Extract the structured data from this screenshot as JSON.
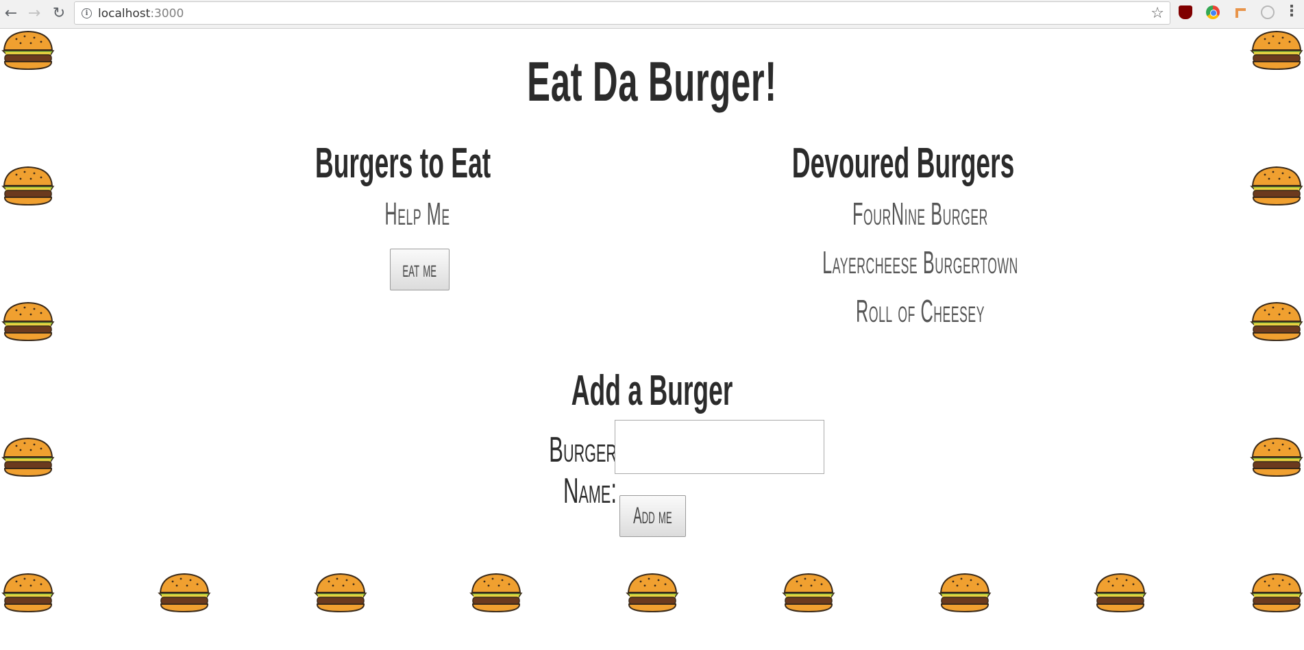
{
  "browser": {
    "url_host": "localhost",
    "url_port": ":3000"
  },
  "page": {
    "title": "Eat Da Burger!",
    "to_eat": {
      "heading": "Burgers to Eat",
      "items": [
        "Help Me"
      ],
      "button_label": "eat me"
    },
    "devoured": {
      "heading": "Devoured Burgers",
      "items": [
        "FourNine Burger",
        "Layercheese Burgertown",
        "Roll of Cheesey"
      ]
    },
    "add_form": {
      "heading": "Add a Burger",
      "name_label": "Burger Name:",
      "name_value": "",
      "button_label": "Add me"
    }
  }
}
